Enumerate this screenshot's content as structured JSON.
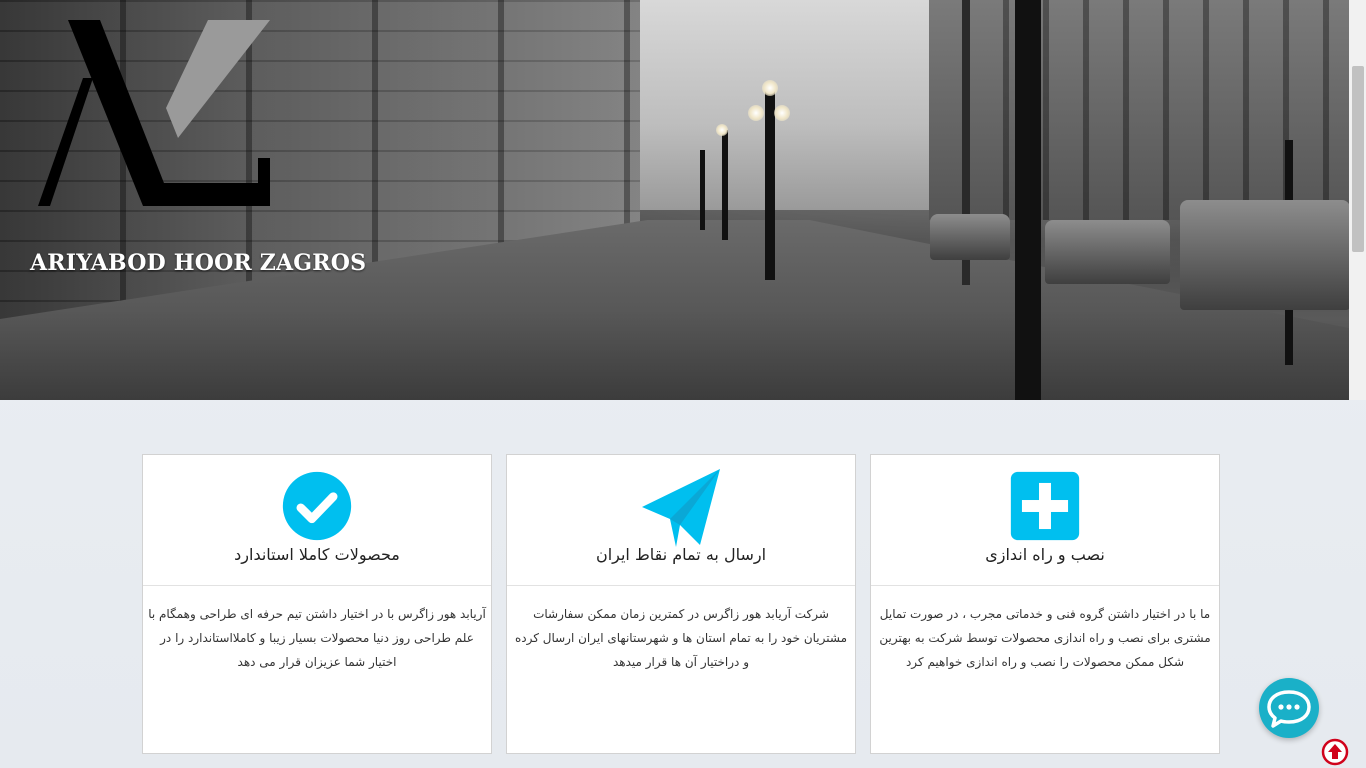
{
  "hero": {
    "brand": "ARIYABOD HOOR ZAGROS",
    "logo_icon": "az-monogram-logo"
  },
  "cards": [
    {
      "icon": "check-circle-icon",
      "title": "محصولات کاملا استاندارد",
      "text": "آریابد هور زاگرس با در اختیار داشتن تیم حرفه ای طراحی وهمگام با علم طراحی روز دنیا محصولات بسیار زیبا و کاملااستاندارد را در اختیار شما عزیزان قرار می دهد"
    },
    {
      "icon": "paper-plane-icon",
      "title": "ارسال به تمام نقاط ایران",
      "text": "شرکت آریابد هور زاگرس در کمترین زمان ممکن سفارشات مشتریان خود را به تمام استان ها و شهرستانهای ایران ارسال کرده و دراختیار آن ها قرار میدهد"
    },
    {
      "icon": "plus-square-icon",
      "title": "نصب و راه اندازی",
      "text": "ما با در اختیار داشتن گروه فنی و خدماتی مجرب ، در صورت تمایل مشتری برای نصب و راه اندازی محصولات توسط شرکت به بهترین شکل ممکن محصولات را نصب و راه اندازی خواهیم کرد"
    }
  ],
  "colors": {
    "accent": "#00bfef",
    "chat": "#1ab0c8",
    "up_arrow": "#d0021b"
  },
  "floating": {
    "chat_icon": "chat-bubble-icon",
    "up_icon": "arrow-up-circle-icon"
  }
}
